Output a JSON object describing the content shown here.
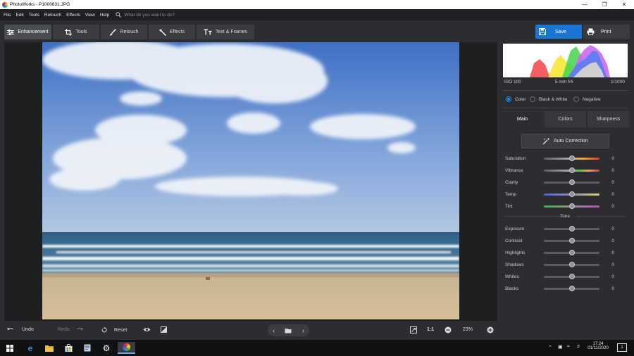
{
  "window": {
    "title": "PhotoWorks - P1000831.JPG"
  },
  "menu": {
    "items": [
      "File",
      "Edit",
      "Tools",
      "Retouch",
      "Effects",
      "View",
      "Help"
    ],
    "search_placeholder": "What do you want to do?"
  },
  "toolbar": {
    "tabs": [
      {
        "label": "Enhancement",
        "active": true
      },
      {
        "label": "Tools"
      },
      {
        "label": "Retouch"
      },
      {
        "label": "Effects"
      },
      {
        "label": "Text & Frames"
      }
    ],
    "save_label": "Save",
    "print_label": "Print"
  },
  "histogram": {
    "iso": "ISO 100",
    "lens": "5 mm f/4",
    "shutter": "1/1000"
  },
  "color_mode": {
    "options": [
      "Color",
      "Black & White",
      "Negative"
    ],
    "selected": "Color"
  },
  "panel_tabs": {
    "items": [
      "Main",
      "Colors",
      "Sharpness"
    ],
    "active": "Main"
  },
  "auto_correction_label": "Auto Correction",
  "color_sliders": [
    {
      "label": "Saturation",
      "value": "0"
    },
    {
      "label": "Vibrance",
      "value": "0"
    },
    {
      "label": "Clarity",
      "value": "0"
    },
    {
      "label": "Temp",
      "value": "0"
    },
    {
      "label": "Tint",
      "value": "0"
    }
  ],
  "tone_label": "Tone",
  "tone_sliders": [
    {
      "label": "Exposure",
      "value": "0"
    },
    {
      "label": "Contrast",
      "value": "0"
    },
    {
      "label": "Highlights",
      "value": "0"
    },
    {
      "label": "Shadows",
      "value": "0"
    },
    {
      "label": "Whites",
      "value": "0"
    },
    {
      "label": "Blacks",
      "value": "0"
    }
  ],
  "bottom": {
    "undo": "Undo",
    "redo": "Redo",
    "reset": "Reset",
    "ratio": "1:1",
    "zoom": "23%"
  },
  "taskbar": {
    "time": "17:24",
    "date": "01/11/2020",
    "notifications": "1"
  },
  "colors": {
    "accent": "#1976d2",
    "panel_bg": "#2b2d30",
    "canvas_bg": "#1e1f21"
  }
}
